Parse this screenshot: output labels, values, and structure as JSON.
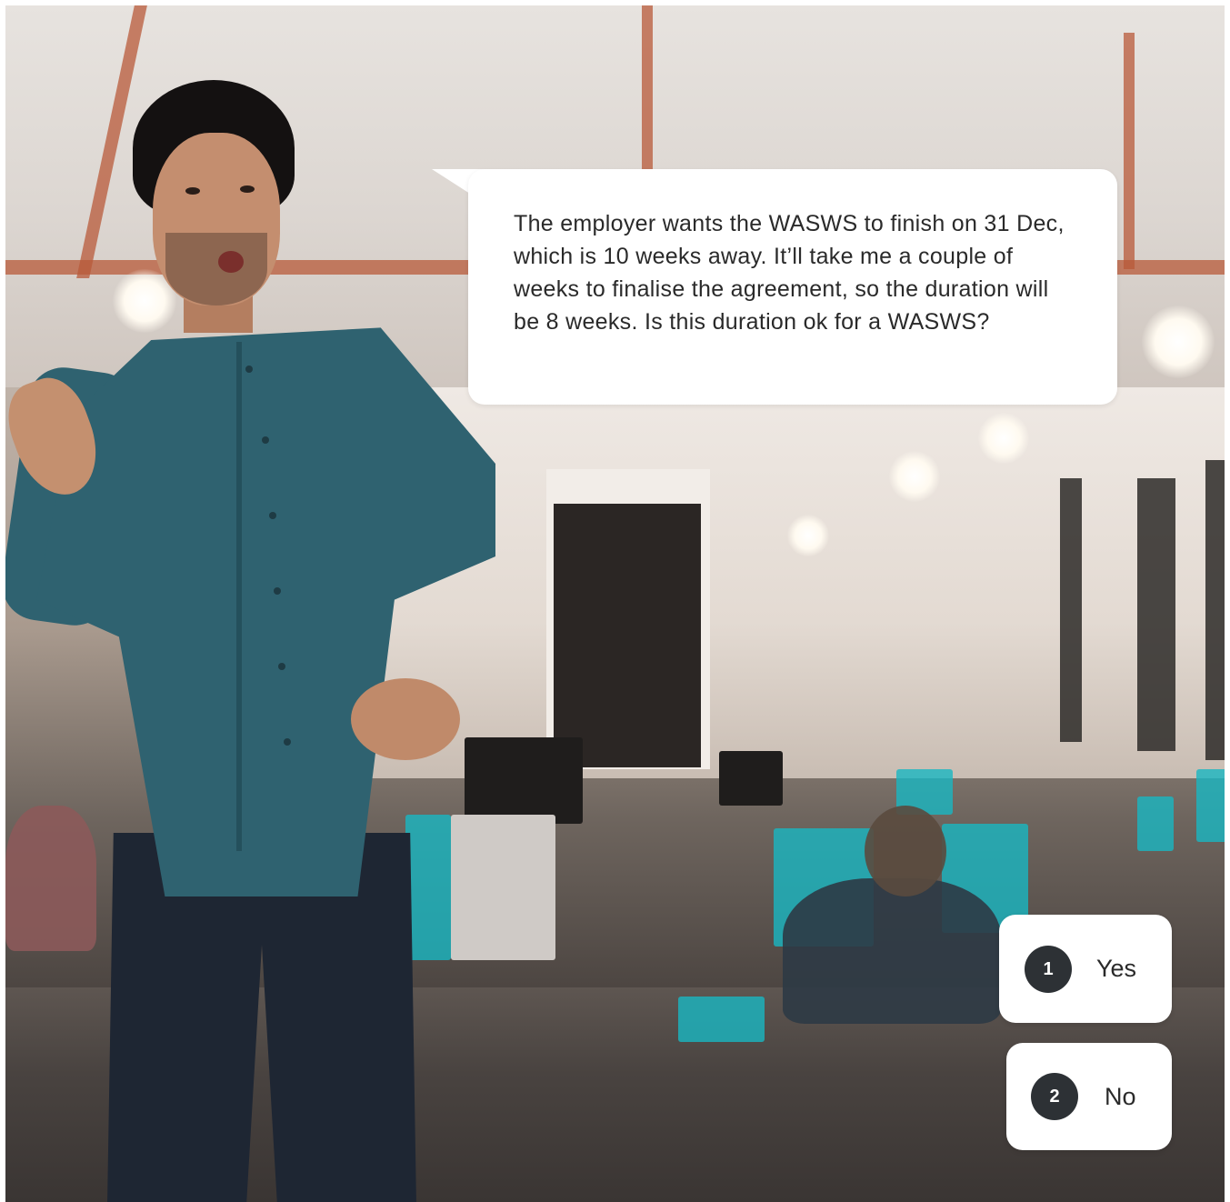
{
  "scene": {
    "speech": "The employer wants the WASWS to finish on 31 Dec, which is 10 weeks away. It’ll take me a couple of weeks to finalise the agreement, so the duration will be 8 weeks. Is this duration ok for a WASWS?"
  },
  "options": [
    {
      "number": "1",
      "label": "Yes"
    },
    {
      "number": "2",
      "label": "No"
    }
  ],
  "colors": {
    "bubble": "#ffffff",
    "option_badge": "#2d3135",
    "shirt": "#2f6270",
    "accent_beam": "#b85a3a"
  },
  "icons": {
    "presenter": "person-figure",
    "background": "office-scene"
  }
}
